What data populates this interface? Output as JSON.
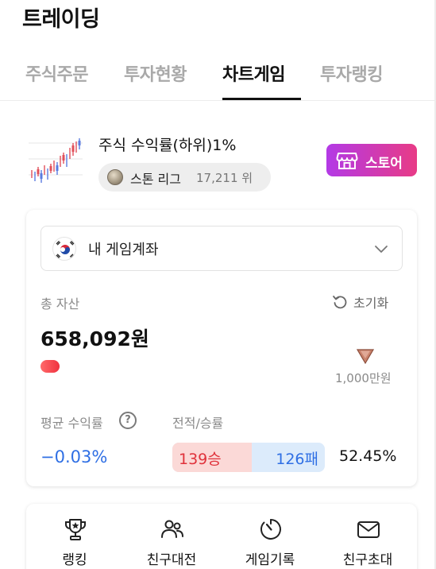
{
  "header": {
    "title": "트레이딩"
  },
  "tabs": [
    {
      "label": "주식주문",
      "active": false
    },
    {
      "label": "투자현황",
      "active": false
    },
    {
      "label": "차트게임",
      "active": true
    },
    {
      "label": "투자랭킹",
      "active": false
    }
  ],
  "profile": {
    "league_title": "주식 수익률(하위)1%",
    "league_name": "스톤 리그",
    "rank": "17,211 위",
    "store_label": "스토어"
  },
  "account": {
    "selector_label": "내 게임계좌",
    "total_label": "총 자산",
    "reset_label": "초기화",
    "total_value": "658,092원",
    "tier_amount": "1,000만원",
    "avg_return_label": "평균 수익률",
    "avg_return_value": "−0.03%",
    "record_label": "전적/승률",
    "wins": "139승",
    "losses": "126패",
    "win_rate": "52.45%"
  },
  "menu": [
    {
      "label": "랭킹",
      "icon": "trophy-icon"
    },
    {
      "label": "친구대전",
      "icon": "friends-icon"
    },
    {
      "label": "게임기록",
      "icon": "timer-icon"
    },
    {
      "label": "친구초대",
      "icon": "mail-icon"
    }
  ],
  "colors": {
    "store_gradient_start": "#b33ae6",
    "store_gradient_end": "#e83b86",
    "win_red": "#e0323b",
    "loss_blue": "#2f6fe4",
    "win_bg": "#fbd9d7",
    "loss_bg": "#dcebfb"
  }
}
